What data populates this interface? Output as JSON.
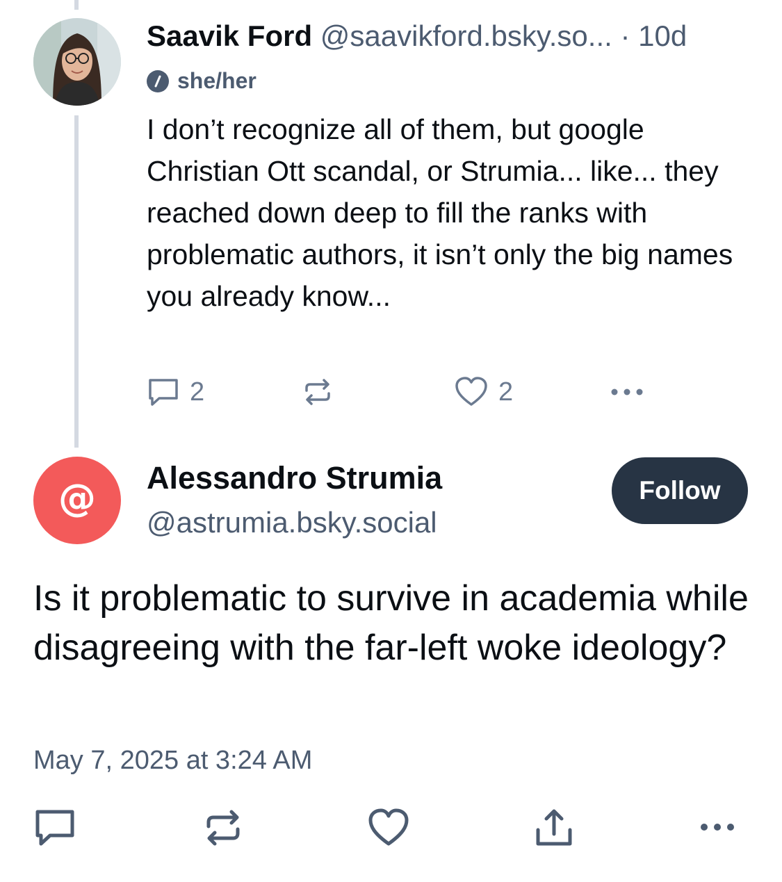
{
  "reply_post": {
    "author_name": "Saavik Ford",
    "author_handle": "@saavikford.bsky.so...",
    "separator": "·",
    "time_ago": "10d",
    "pronouns": "she/her",
    "text": "I don’t recognize all of them, but google Christian Ott scandal, or Strumia... like... they reached down deep to fill the ranks with problematic authors, it isn’t only the big names you already know...",
    "reply_count": "2",
    "like_count": "2"
  },
  "main_post": {
    "author_name": "Alessandro Strumia",
    "author_handle": "@astrumia.bsky.social",
    "avatar_glyph": "@",
    "follow_label": "Follow",
    "text": "Is it problematic to survive in academia while disagreeing with the far-left woke ideology?",
    "timestamp": "May 7, 2025 at 3:24 AM"
  },
  "colors": {
    "text": "#0b0f14",
    "muted": "#4c5b70",
    "icon": "#6b7a90",
    "follow_bg": "#273444",
    "avatar_red": "#f35a5a",
    "thread_line": "#d4d9e1"
  },
  "icons": {
    "reply": "speech-bubble-icon",
    "repost": "repost-arrows-icon",
    "like": "heart-icon",
    "share": "share-upload-icon",
    "more": "ellipsis-icon",
    "pronoun_badge": "info-slash-icon"
  }
}
